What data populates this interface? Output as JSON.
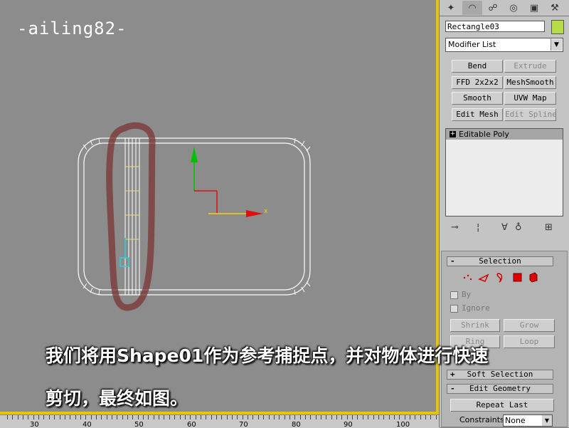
{
  "watermark": "-ailing82-",
  "viewport": {
    "axis_label": "x"
  },
  "ruler": {
    "labels": [
      "30",
      "40",
      "50",
      "60",
      "70",
      "80",
      "90",
      "100"
    ]
  },
  "command_panel": {
    "tab_icons": [
      "create-icon",
      "modify-icon",
      "hierarchy-icon",
      "motion-icon",
      "display-icon",
      "utilities-icon"
    ],
    "object_name": "Rectangle03",
    "object_color": "#b4dd48",
    "modifier_list": "Modifier List",
    "modifier_buttons": [
      {
        "label": "Bend",
        "enabled": true
      },
      {
        "label": "Extrude",
        "enabled": false
      },
      {
        "label": "FFD 2x2x2",
        "enabled": true
      },
      {
        "label": "MeshSmooth",
        "enabled": true
      },
      {
        "label": "Smooth",
        "enabled": true
      },
      {
        "label": "UVW Map",
        "enabled": true
      },
      {
        "label": "Edit Mesh",
        "enabled": true
      },
      {
        "label": "Edit Spline",
        "enabled": false
      }
    ],
    "stack_item": "Editable Poly",
    "rollouts": {
      "selection": "Selection",
      "by": "By",
      "ignore": "Ignore",
      "shrink": "Shrink",
      "grow": "Grow",
      "ring": "Ring",
      "loop": "Loop",
      "soft_selection": "Soft Selection",
      "edit_geometry": "Edit Geometry",
      "repeat_last": "Repeat Last",
      "constraints_label": "Constraints:",
      "constraints_value": "None"
    }
  },
  "subtitle": {
    "line1": "我们将用Shape01作为参考捕捉点，并对物体进行快速",
    "line2": "剪切，最终如图。"
  }
}
